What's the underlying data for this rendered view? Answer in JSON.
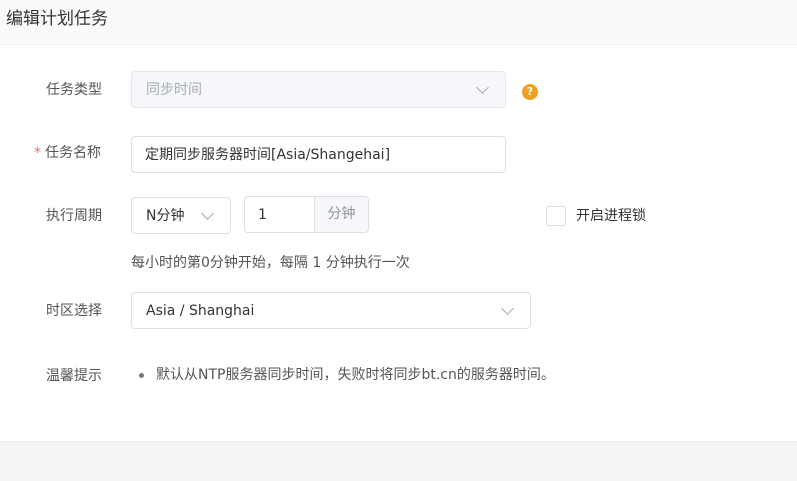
{
  "dialog": {
    "title": "编辑计划任务"
  },
  "task_type": {
    "label": "任务类型",
    "value": "同步时间",
    "help_icon": "question-circle-icon"
  },
  "task_name": {
    "required_mark": "*",
    "label": "任务名称",
    "value": "定期同步服务器时间[Asia/Shangehai]"
  },
  "cycle": {
    "label": "执行周期",
    "type_value": "N分钟",
    "interval_value": "1",
    "interval_unit": "分钟",
    "lock_label": "开启进程锁",
    "lock_checked": false,
    "hint": "每小时的第0分钟开始，每隔 1 分钟执行一次"
  },
  "timezone": {
    "label": "时区选择",
    "value": "Asia / Shanghai"
  },
  "tips": {
    "label": "温馨提示",
    "items": [
      "默认从NTP服务器同步时间，失败时将同步bt.cn的服务器时间。"
    ]
  },
  "colors": {
    "required": "#f56c6c",
    "help": "#f0a020",
    "border": "#dcdfe6"
  }
}
